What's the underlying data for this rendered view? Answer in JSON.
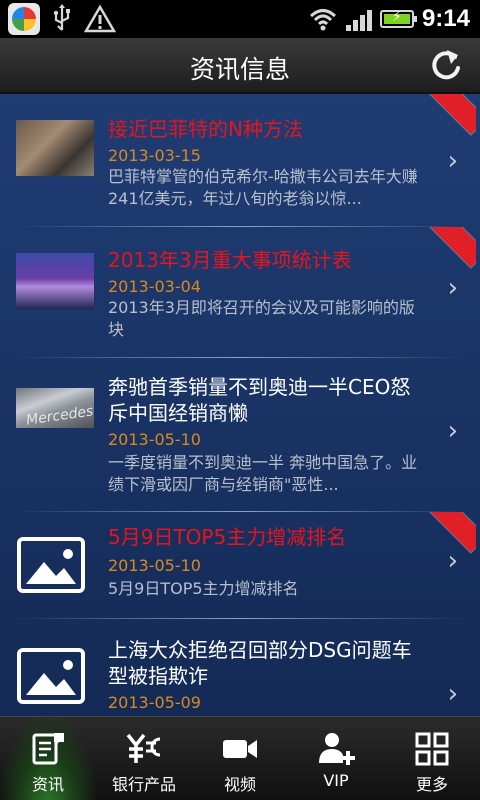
{
  "status_bar": {
    "time": "9:14",
    "icons": [
      "app-icon",
      "usb-icon",
      "warning-icon",
      "wifi-icon",
      "signal-icon",
      "battery-icon"
    ]
  },
  "header": {
    "title": "资讯信息",
    "refresh_icon": "refresh-icon"
  },
  "news": [
    {
      "title": "接近巴菲特的N种方法",
      "date": "2013-03-15",
      "summary": "巴菲特掌管的伯克希尔-哈撒韦公司去年大赚241亿美元，年过八旬的老翁以惊...",
      "title_color": "#e8141c",
      "highlight": true,
      "thumbnail": "photo"
    },
    {
      "title": "2013年3月重大事项统计表",
      "date": "2013-03-04",
      "summary": "2013年3月即将召开的会议及可能影响的版块",
      "title_color": "#e8141c",
      "highlight": true,
      "thumbnail": "photo"
    },
    {
      "title": "奔驰首季销量不到奥迪一半CEO怒斥中国经销商懒",
      "date": "2013-05-10",
      "summary": "一季度销量不到奥迪一半 奔驰中国急了。业绩下滑或因厂商与经销商\"恶性...",
      "title_color": "#ffffff",
      "highlight": false,
      "thumbnail": "photo",
      "thumbnail_text": "Mercedes"
    },
    {
      "title": "5月9日TOP5主力增减排名",
      "date": "2013-05-10",
      "summary": "5月9日TOP5主力增减排名",
      "title_color": "#e8141c",
      "highlight": true,
      "thumbnail": "image-placeholder-icon"
    },
    {
      "title": "上海大众拒绝召回部分DSG问题车型被指欺诈",
      "date": "2013-05-09",
      "summary": "",
      "title_color": "#ffffff",
      "highlight": false,
      "thumbnail": "image-placeholder-icon"
    }
  ],
  "tabs": [
    {
      "label": "资讯",
      "icon": "news-icon",
      "active": true
    },
    {
      "label": "银行产品",
      "icon": "bank-product-icon",
      "active": false
    },
    {
      "label": "视频",
      "icon": "video-camera-icon",
      "active": false
    },
    {
      "label": "VIP",
      "icon": "add-user-icon",
      "active": false
    },
    {
      "label": "更多",
      "icon": "more-grid-icon",
      "active": false
    }
  ],
  "colors": {
    "list_background": "#1f3c73",
    "highlight_title": "#e8141c",
    "date": "#d98a1e",
    "ribbon": "#e01f26"
  }
}
